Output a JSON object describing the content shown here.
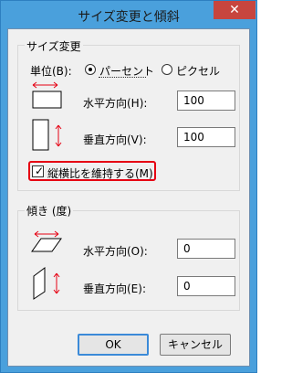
{
  "window": {
    "title": "サイズ変更と傾斜",
    "close_label": "✕"
  },
  "resize": {
    "group_title": "サイズ変更",
    "unit_label": "単位(B):",
    "unit_options": [
      "パーセント",
      "ピクセル"
    ],
    "selected_unit": "パーセント",
    "horizontal_label": "水平方向(H):",
    "horizontal_value": "100",
    "vertical_label": "垂直方向(V):",
    "vertical_value": "100",
    "keep_aspect_label": "縦横比を維持する(M)",
    "keep_aspect_checked": true
  },
  "skew": {
    "group_title": "傾き (度)",
    "horizontal_label": "水平方向(O):",
    "horizontal_value": "0",
    "vertical_label": "垂直方向(E):",
    "vertical_value": "0"
  },
  "buttons": {
    "ok": "OK",
    "cancel": "キャンセル"
  },
  "colors": {
    "titlebar": "#4aa0dc",
    "accent_red": "#e60012",
    "close": "#c7453e"
  },
  "icons": [
    "close-icon",
    "horizontal-resize-icon",
    "vertical-resize-icon",
    "horizontal-skew-icon",
    "vertical-skew-icon",
    "checkbox-check-icon"
  ]
}
